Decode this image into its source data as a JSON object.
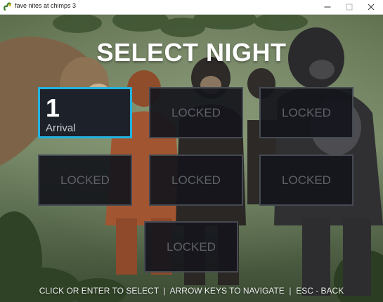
{
  "window": {
    "title": "fave nites at chimps 3"
  },
  "screen": {
    "heading": "SELECT NIGHT",
    "nights": [
      {
        "number": "1",
        "name": "Arrival",
        "state": "unlocked",
        "selected": true
      },
      {
        "label": "LOCKED",
        "state": "locked"
      },
      {
        "label": "LOCKED",
        "state": "locked"
      },
      {
        "label": "LOCKED",
        "state": "locked"
      },
      {
        "label": "LOCKED",
        "state": "locked"
      },
      {
        "label": "LOCKED",
        "state": "locked"
      },
      {
        "label": "LOCKED",
        "state": "locked"
      }
    ],
    "hint": "CLICK OR ENTER TO SELECT  |  ARROW KEYS TO NAVIGATE  |  ESC - BACK"
  },
  "colors": {
    "selection_border": "#21b4e0",
    "tile_background": "#16181e",
    "locked_text": "#5e6168",
    "heading_text": "#ffffff"
  },
  "icons": {
    "app": "pygame-snake-icon",
    "minimize": "minimize-icon",
    "maximize": "maximize-icon",
    "close": "close-icon"
  }
}
